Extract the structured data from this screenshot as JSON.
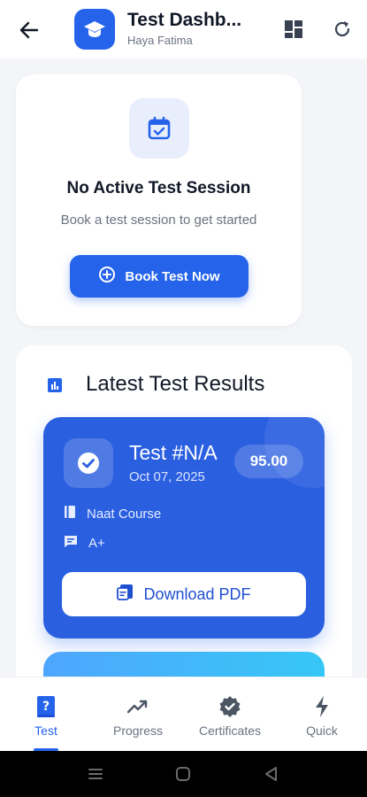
{
  "header": {
    "title": "Test Dashb...",
    "subtitle": "Haya Fatima",
    "icons": [
      "back-arrow-icon",
      "graduation-cap-icon",
      "dashboard-grid-icon",
      "refresh-icon"
    ]
  },
  "empty_session": {
    "title": "No Active Test Session",
    "subtitle": "Book a test session to get started",
    "button_label": "Book Test Now",
    "icon": "calendar-check-icon"
  },
  "results": {
    "section_title": "Latest Test Results",
    "cards": [
      {
        "test_number": "Test #N/A",
        "date": "Oct 07, 2025",
        "score": "95.00",
        "course": "Naat Course",
        "grade": "A+",
        "download_label": "Download PDF"
      }
    ]
  },
  "bottom_nav": {
    "items": [
      {
        "label": "Test",
        "icon": "question-book-icon",
        "active": true
      },
      {
        "label": "Progress",
        "icon": "trending-up-icon",
        "active": false
      },
      {
        "label": "Certificates",
        "icon": "verified-badge-icon",
        "active": false
      },
      {
        "label": "Quick",
        "icon": "lightning-icon",
        "active": false
      }
    ]
  },
  "colors": {
    "primary": "#2563eb",
    "card_blue": "#2a5fe0",
    "background": "#f3f5f8"
  }
}
